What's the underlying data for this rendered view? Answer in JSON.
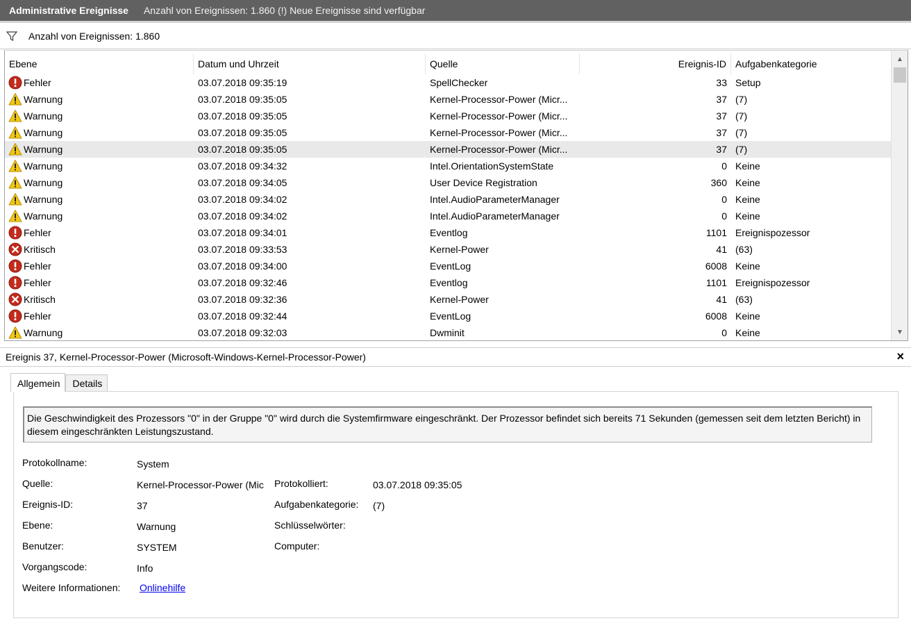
{
  "titlebar": {
    "title": "Administrative Ereignisse",
    "info": "Anzahl von Ereignissen: 1.860 (!) Neue Ereignisse sind verfügbar"
  },
  "filterbar": {
    "label": "Anzahl von Ereignissen: 1.860"
  },
  "columns": {
    "level": "Ebene",
    "date": "Datum und Uhrzeit",
    "source": "Quelle",
    "event_id": "Ereignis-ID",
    "category": "Aufgabenkategorie"
  },
  "rows": [
    {
      "level": "Fehler",
      "icon": "error-icon",
      "date": "03.07.2018 09:35:19",
      "source": "SpellChecker",
      "id": "33",
      "category": "Setup"
    },
    {
      "level": "Warnung",
      "icon": "warning-icon",
      "date": "03.07.2018 09:35:05",
      "source": "Kernel-Processor-Power (Micr...",
      "id": "37",
      "category": "(7)"
    },
    {
      "level": "Warnung",
      "icon": "warning-icon",
      "date": "03.07.2018 09:35:05",
      "source": "Kernel-Processor-Power (Micr...",
      "id": "37",
      "category": "(7)"
    },
    {
      "level": "Warnung",
      "icon": "warning-icon",
      "date": "03.07.2018 09:35:05",
      "source": "Kernel-Processor-Power (Micr...",
      "id": "37",
      "category": "(7)"
    },
    {
      "level": "Warnung",
      "icon": "warning-icon",
      "date": "03.07.2018 09:35:05",
      "source": "Kernel-Processor-Power (Micr...",
      "id": "37",
      "category": "(7)"
    },
    {
      "level": "Warnung",
      "icon": "warning-icon",
      "date": "03.07.2018 09:34:32",
      "source": "Intel.OrientationSystemState",
      "id": "0",
      "category": "Keine"
    },
    {
      "level": "Warnung",
      "icon": "warning-icon",
      "date": "03.07.2018 09:34:05",
      "source": "User Device Registration",
      "id": "360",
      "category": "Keine"
    },
    {
      "level": "Warnung",
      "icon": "warning-icon",
      "date": "03.07.2018 09:34:02",
      "source": "Intel.AudioParameterManager",
      "id": "0",
      "category": "Keine"
    },
    {
      "level": "Warnung",
      "icon": "warning-icon",
      "date": "03.07.2018 09:34:02",
      "source": "Intel.AudioParameterManager",
      "id": "0",
      "category": "Keine"
    },
    {
      "level": "Fehler",
      "icon": "error-icon",
      "date": "03.07.2018 09:34:01",
      "source": "Eventlog",
      "id": "1101",
      "category": "Ereignispozessor"
    },
    {
      "level": "Kritisch",
      "icon": "critical-icon",
      "date": "03.07.2018 09:33:53",
      "source": "Kernel-Power",
      "id": "41",
      "category": "(63)"
    },
    {
      "level": "Fehler",
      "icon": "error-icon",
      "date": "03.07.2018 09:34:00",
      "source": "EventLog",
      "id": "6008",
      "category": "Keine"
    },
    {
      "level": "Fehler",
      "icon": "error-icon",
      "date": "03.07.2018 09:32:46",
      "source": "Eventlog",
      "id": "1101",
      "category": "Ereignispozessor"
    },
    {
      "level": "Kritisch",
      "icon": "critical-icon",
      "date": "03.07.2018 09:32:36",
      "source": "Kernel-Power",
      "id": "41",
      "category": "(63)"
    },
    {
      "level": "Fehler",
      "icon": "error-icon",
      "date": "03.07.2018 09:32:44",
      "source": "EventLog",
      "id": "6008",
      "category": "Keine"
    },
    {
      "level": "Warnung",
      "icon": "warning-icon",
      "date": "03.07.2018 09:32:03",
      "source": "Dwminit",
      "id": "0",
      "category": "Keine"
    }
  ],
  "selected_row": 4,
  "detail": {
    "header": "Ereignis 37, Kernel-Processor-Power (Microsoft-Windows-Kernel-Processor-Power)",
    "close": "×",
    "tabs": [
      "Allgemein",
      "Details"
    ],
    "description": "Die Geschwindigkeit des Prozessors \"0\" in der Gruppe \"0\" wird durch die Systemfirmware eingeschränkt. Der Prozessor befindet sich bereits 71 Sekunden (gemessen seit dem letzten Bericht) in diesem eingeschränkten Leistungszustand.",
    "labels": {
      "log_name": "Protokollname:",
      "source": "Quelle:",
      "event_id": "Ereignis-ID:",
      "level": "Ebene:",
      "user": "Benutzer:",
      "opcode": "Vorgangscode:",
      "more_info": "Weitere Informationen:",
      "logged": "Protokolliert:",
      "task_category": "Aufgabenkategorie:",
      "keywords": "Schlüsselwörter:",
      "computer": "Computer:"
    },
    "values": {
      "log_name": "System",
      "source": "Kernel-Processor-Power (Mic",
      "event_id": "37",
      "level": "Warnung",
      "user": "SYSTEM",
      "opcode": "Info",
      "more_info_link": "Onlinehilfe",
      "logged": "03.07.2018 09:35:05",
      "task_category": "(7)"
    }
  },
  "colors": {
    "titlebar": "#616161",
    "error": "#c42b1c",
    "warning": "#f2c811",
    "critical": "#c42b1c",
    "link": "#0000ee"
  }
}
